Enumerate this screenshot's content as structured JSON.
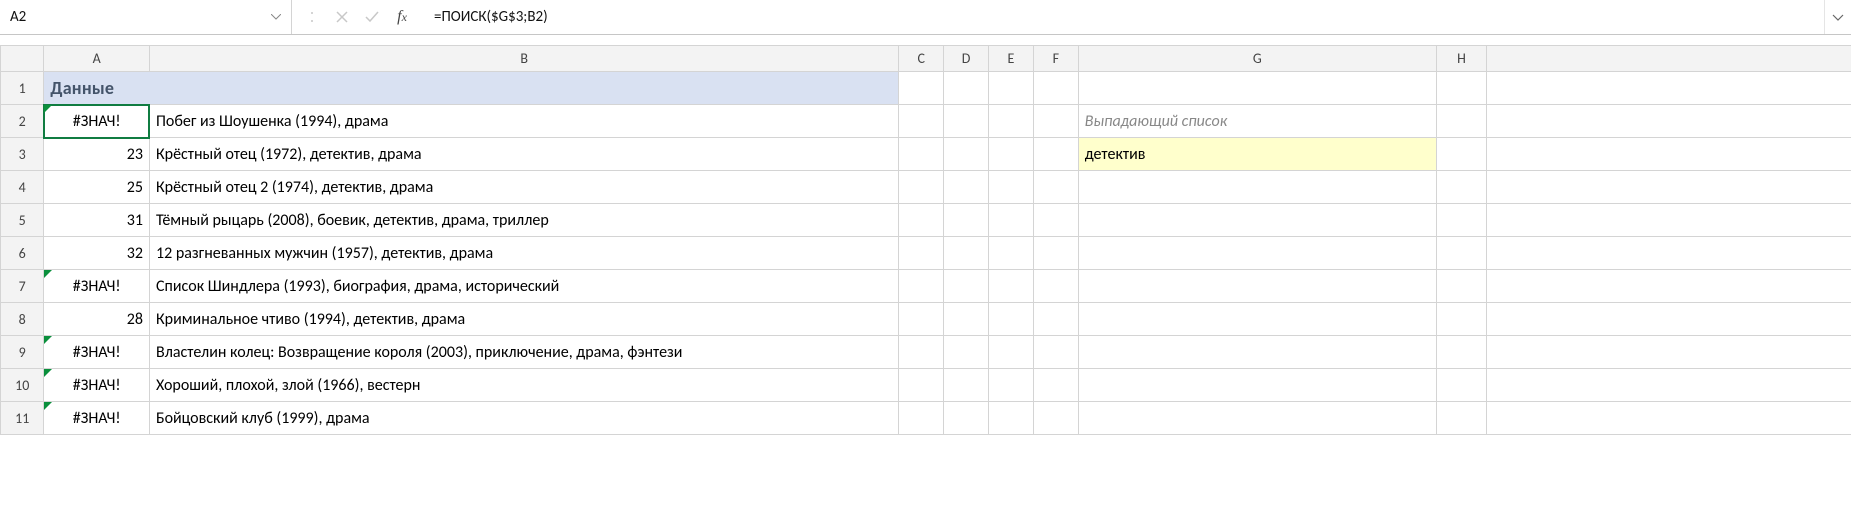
{
  "formula_bar": {
    "name_box": "A2",
    "formula": "=ПОИСК($G$3;B2)",
    "cancel_icon": "✕",
    "enter_icon": "✓",
    "fx_label_f": "f",
    "fx_label_x": "x"
  },
  "columns": {
    "A": "A",
    "B": "B",
    "C": "C",
    "D": "D",
    "E": "E",
    "F": "F",
    "G": "G",
    "H": "H"
  },
  "rowlabels": {
    "1": "1",
    "2": "2",
    "3": "3",
    "4": "4",
    "5": "5",
    "6": "6",
    "7": "7",
    "8": "8",
    "9": "9",
    "10": "10",
    "11": "11"
  },
  "cells": {
    "title": "Данные",
    "g2": "Выпадающий список",
    "g3": "детектив",
    "rows": [
      {
        "a": "#ЗНАЧ!",
        "b": "Побег из Шоушенка (1994), драма",
        "err": true
      },
      {
        "a": "23",
        "b": "Крёстный отец (1972), детектив, драма",
        "err": false
      },
      {
        "a": "25",
        "b": "Крёстный отец 2 (1974), детектив, драма",
        "err": false
      },
      {
        "a": "31",
        "b": "Тёмный рыцарь (2008), боевик, детектив, драма, триллер",
        "err": false
      },
      {
        "a": "32",
        "b": "12 разгневанных мужчин (1957), детектив, драма",
        "err": false
      },
      {
        "a": "#ЗНАЧ!",
        "b": "Список Шиндлера (1993), биография, драма, исторический",
        "err": true
      },
      {
        "a": "28",
        "b": "Криминальное чтиво (1994), детектив, драма",
        "err": false
      },
      {
        "a": "#ЗНАЧ!",
        "b": "Властелин колец: Возвращение короля (2003), приключение, драма, фэнтези",
        "err": true
      },
      {
        "a": "#ЗНАЧ!",
        "b": "Хороший, плохой, злой (1966), вестерн",
        "err": true
      },
      {
        "a": "#ЗНАЧ!",
        "b": "Бойцовский клуб (1999), драма",
        "err": true
      }
    ]
  },
  "colors": {
    "accent_selection": "#107c41",
    "header_fill": "#d9e1f2",
    "header_font": "#44546a",
    "highlight_fill": "#ffffcc"
  }
}
